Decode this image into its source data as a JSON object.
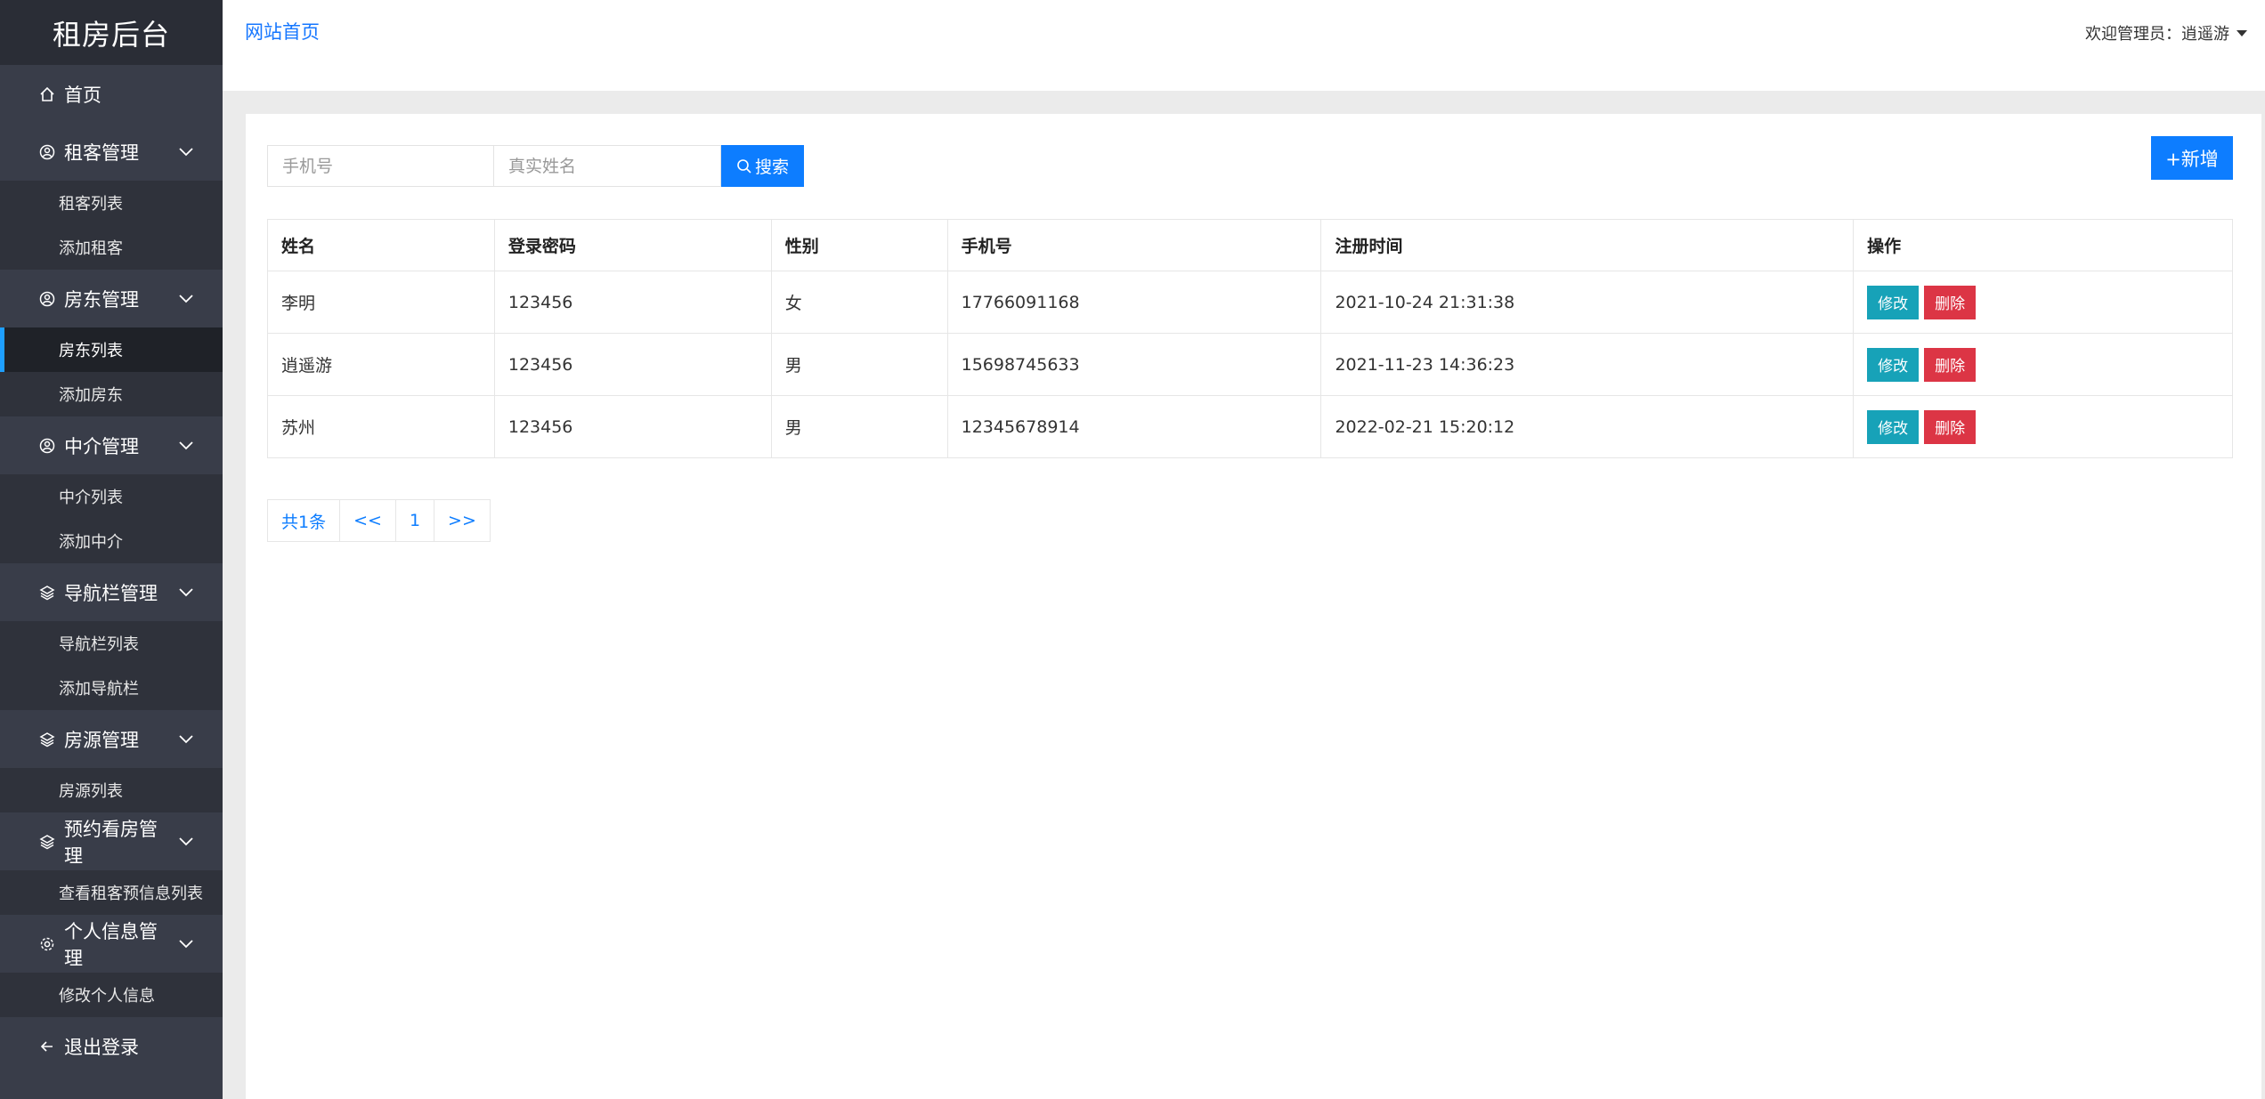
{
  "sidebar": {
    "brand": "租房后台",
    "home": "首页",
    "groups": [
      {
        "title": "租客管理",
        "icon": "user-circle-icon",
        "items": [
          "租客列表",
          "添加租客"
        ]
      },
      {
        "title": "房东管理",
        "icon": "user-circle-icon",
        "items": [
          "房东列表",
          "添加房东"
        ]
      },
      {
        "title": "中介管理",
        "icon": "user-circle-icon",
        "items": [
          "中介列表",
          "添加中介"
        ]
      },
      {
        "title": "导航栏管理",
        "icon": "layers-icon",
        "items": [
          "导航栏列表",
          "添加导航栏"
        ]
      },
      {
        "title": "房源管理",
        "icon": "layers-icon",
        "items": [
          "房源列表"
        ]
      },
      {
        "title": "预约看房管理",
        "icon": "layers-icon",
        "items": [
          "查看租客预信息列表"
        ]
      },
      {
        "title": "个人信息管理",
        "icon": "gear-icon",
        "items": [
          "修改个人信息"
        ]
      }
    ],
    "active_item": "房东列表",
    "logout": "退出登录"
  },
  "header": {
    "home_link": "网站首页",
    "admin": "欢迎管理员：逍遥游"
  },
  "search": {
    "phone_placeholder": "手机号",
    "name_placeholder": "真实姓名",
    "button": "搜索"
  },
  "new_button": "+新增",
  "table": {
    "columns": [
      "姓名",
      "登录密码",
      "性别",
      "手机号",
      "注册时间",
      "操作"
    ],
    "rows": [
      [
        "李明",
        "123456",
        "女",
        "17766091168",
        "2021-10-24 21:31:38"
      ],
      [
        "逍遥游",
        "123456",
        "男",
        "15698745633",
        "2021-11-23 14:36:23"
      ],
      [
        "苏州",
        "123456",
        "男",
        "12345678914",
        "2022-02-21 15:20:12"
      ]
    ],
    "edit_label": "修改",
    "delete_label": "删除"
  },
  "pager": {
    "total": "共1条",
    "prev": "<<",
    "page": "1",
    "next": ">>"
  },
  "colors": {
    "sidebar_bg": "#393d49",
    "primary": "#0d7dff",
    "edit": "#17a2b8",
    "delete": "#dc3545"
  }
}
